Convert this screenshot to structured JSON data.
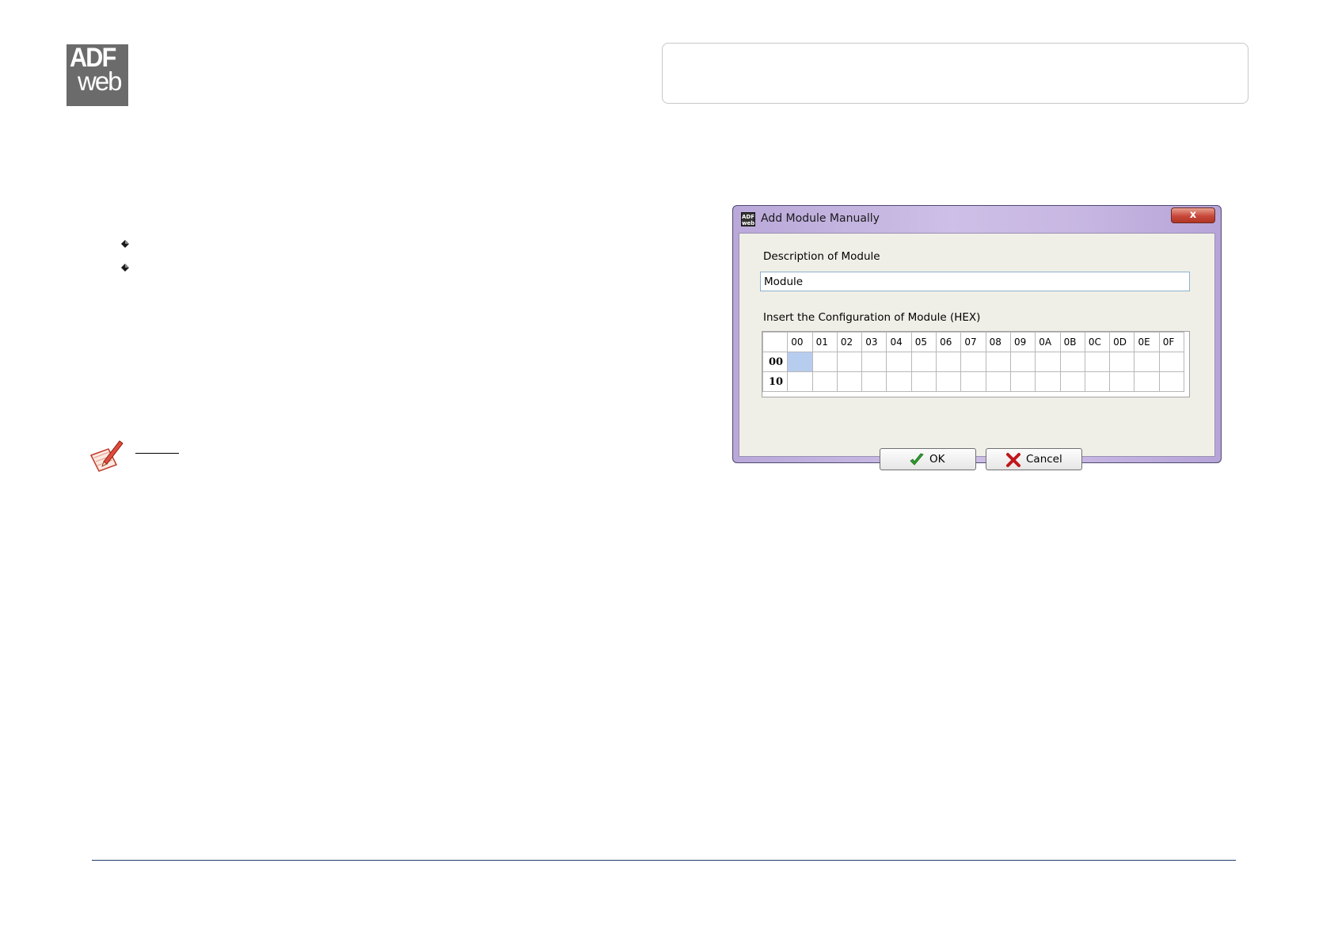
{
  "logo": {
    "line1": "ADF",
    "line2": "web"
  },
  "dialog": {
    "title": "Add Module Manually",
    "close_label": "x",
    "description_label": "Description of Module",
    "description_value": "Module",
    "config_label": "Insert the Configuration of Module (HEX)",
    "columns": [
      "00",
      "01",
      "02",
      "03",
      "04",
      "05",
      "06",
      "07",
      "08",
      "09",
      "0A",
      "0B",
      "0C",
      "0D",
      "0E",
      "0F"
    ],
    "rows": [
      "00",
      "10"
    ],
    "ok_label": "OK",
    "cancel_label": "Cancel"
  },
  "colors": {
    "title_gradient": "#c7b7e2",
    "selected_cell": "#b7cdf0",
    "close_red": "#c8483a",
    "footer_line": "#1f3a6b"
  },
  "icons": {
    "bullet": "diamond-bullet-icon",
    "note": "note-pencil-icon",
    "ok": "checkmark-icon",
    "cancel": "red-x-icon"
  }
}
